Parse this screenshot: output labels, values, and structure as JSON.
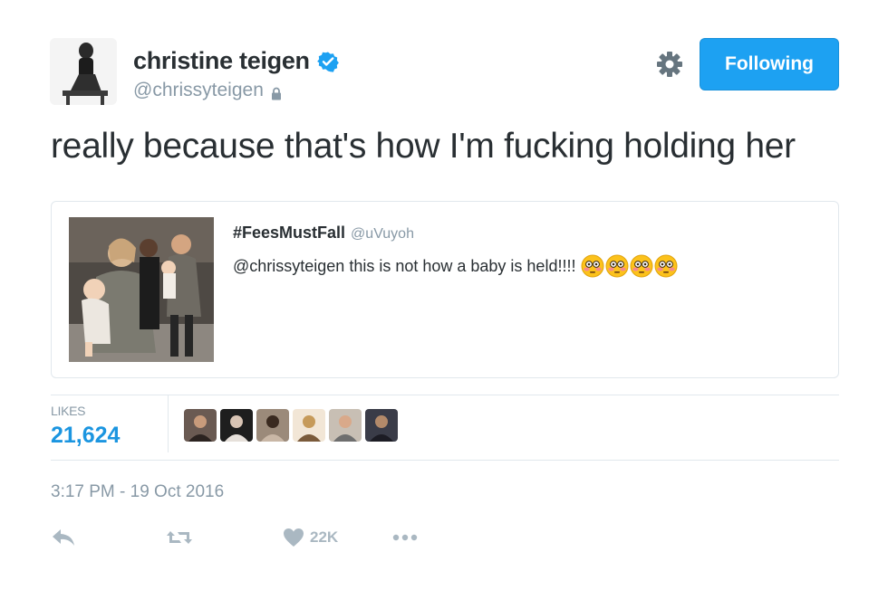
{
  "author": {
    "name": "christine teigen",
    "handle": "@chrissyteigen"
  },
  "header": {
    "follow_label": "Following"
  },
  "tweet": {
    "text": "really because that's how I'm fucking holding her",
    "timestamp": "3:17 PM - 19 Oct 2016"
  },
  "quoted_tweet": {
    "name": "#FeesMustFall",
    "handle": "@uVuyoh",
    "text": "@chrissyteigen this is not how a baby is held!!!!",
    "emojis": [
      "flushed-face-icon",
      "flushed-face-icon",
      "flushed-face-icon",
      "flushed-face-icon"
    ]
  },
  "stats": {
    "likes_label": "LIKES",
    "likes_value": "21,624",
    "likers_count": 6
  },
  "actions": {
    "reply_icon": "reply-icon",
    "retweet_icon": "retweet-icon",
    "like_icon": "heart-icon",
    "like_count": "22K",
    "more_icon": "more-icon"
  },
  "colors": {
    "accent": "#1da1f2",
    "link_blue": "#1b95e0",
    "muted": "#8899a6",
    "text": "#292f33",
    "border": "#e1e8ed"
  }
}
